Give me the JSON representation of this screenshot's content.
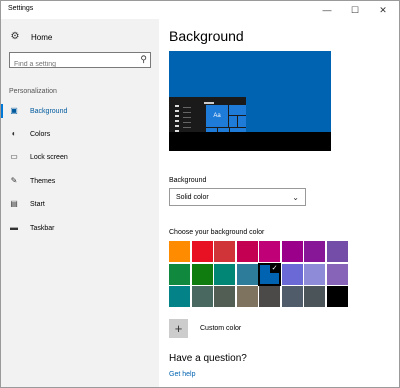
{
  "window": {
    "title": "Settings",
    "minimize_glyph": "—",
    "maximize_glyph": "☐",
    "close_glyph": "✕"
  },
  "sidebar": {
    "home_label": "Home",
    "home_icon": "gear-icon",
    "search_placeholder": "Find a setting",
    "search_icon": "search-icon",
    "section_title": "Personalization",
    "items": [
      {
        "label": "Background",
        "icon": "picture-icon",
        "active": true
      },
      {
        "label": "Colors",
        "icon": "palette-icon",
        "active": false
      },
      {
        "label": "Lock screen",
        "icon": "monitor-icon",
        "active": false
      },
      {
        "label": "Themes",
        "icon": "brush-icon",
        "active": false
      },
      {
        "label": "Start",
        "icon": "start-icon",
        "active": false
      },
      {
        "label": "Taskbar",
        "icon": "taskbar-icon",
        "active": false
      }
    ]
  },
  "main": {
    "title": "Background",
    "preview": {
      "tile_text": "Aa"
    },
    "background_label": "Background",
    "background_value": "Solid color",
    "color_heading": "Choose your background color",
    "selected_color": "#0063b1",
    "colors": [
      [
        "#ff8c00",
        "#e81123",
        "#d13438",
        "#c30052",
        "#bf0077",
        "#9a0089",
        "#881798",
        "#744da9"
      ],
      [
        "#10893e",
        "#107c10",
        "#018574",
        "#2d7d9a",
        "#0063b1",
        "#6b69d6",
        "#8e8cd8",
        "#8764b8"
      ],
      [
        "#038387",
        "#486860",
        "#525e54",
        "#7e735f",
        "#4c4a48",
        "#515c6b",
        "#4a5459",
        "#000000"
      ]
    ],
    "custom_color_label": "Custom color",
    "question_title": "Have a question?",
    "help_link": "Get help"
  }
}
